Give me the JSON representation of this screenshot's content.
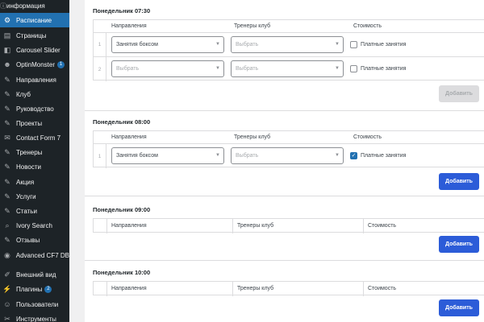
{
  "sidebar": {
    "top_label": "информация",
    "items": [
      {
        "label": "Расписание",
        "icon": "calendar-icon",
        "glyph": "⚙",
        "active": true,
        "badge": ""
      },
      {
        "label": "Страницы",
        "icon": "pages-icon",
        "glyph": "▤",
        "active": false,
        "badge": ""
      },
      {
        "label": "Carousel Slider",
        "icon": "slider-icon",
        "glyph": "◧",
        "active": false,
        "badge": ""
      },
      {
        "label": "OptinMonster",
        "icon": "optinmonster-icon",
        "glyph": "☻",
        "active": false,
        "badge": "1"
      },
      {
        "label": "Направления",
        "icon": "pin-icon",
        "glyph": "✎",
        "active": false,
        "badge": ""
      },
      {
        "label": "Клуб",
        "icon": "pin-icon",
        "glyph": "✎",
        "active": false,
        "badge": ""
      },
      {
        "label": "Руководство",
        "icon": "pin-icon",
        "glyph": "✎",
        "active": false,
        "badge": ""
      },
      {
        "label": "Проекты",
        "icon": "pin-icon",
        "glyph": "✎",
        "active": false,
        "badge": ""
      },
      {
        "label": "Contact Form 7",
        "icon": "mail-icon",
        "glyph": "✉",
        "active": false,
        "badge": ""
      },
      {
        "label": "Тренеры",
        "icon": "pin-icon",
        "glyph": "✎",
        "active": false,
        "badge": ""
      },
      {
        "label": "Новости",
        "icon": "pin-icon",
        "glyph": "✎",
        "active": false,
        "badge": ""
      },
      {
        "label": "Акция",
        "icon": "pin-icon",
        "glyph": "✎",
        "active": false,
        "badge": ""
      },
      {
        "label": "Услуги",
        "icon": "pin-icon",
        "glyph": "✎",
        "active": false,
        "badge": ""
      },
      {
        "label": "Статьи",
        "icon": "pin-icon",
        "glyph": "✎",
        "active": false,
        "badge": ""
      },
      {
        "label": "Ivory Search",
        "icon": "search-icon",
        "glyph": "⌕",
        "active": false,
        "badge": ""
      },
      {
        "label": "Отзывы",
        "icon": "pin-icon",
        "glyph": "✎",
        "active": false,
        "badge": ""
      },
      {
        "label": "Advanced CF7 DB",
        "icon": "eye-icon",
        "glyph": "◉",
        "active": false,
        "badge": ""
      },
      {
        "label": "Внешний вид",
        "icon": "brush-icon",
        "glyph": "✐",
        "active": false,
        "badge": ""
      },
      {
        "label": "Плагины",
        "icon": "plugin-icon",
        "glyph": "⚡",
        "active": false,
        "badge": "2"
      },
      {
        "label": "Пользователи",
        "icon": "user-icon",
        "glyph": "☺",
        "active": false,
        "badge": ""
      },
      {
        "label": "Инструменты",
        "icon": "wrench-icon",
        "glyph": "✂",
        "active": false,
        "badge": ""
      }
    ]
  },
  "columns": {
    "direction": "Направления",
    "trainers": "Тренеры клуб",
    "cost": "Стоимость"
  },
  "paid_label": "Платные занятия",
  "add_label": "Добавить",
  "sections": [
    {
      "title": "Понедельник 07:30",
      "rows": [
        {
          "num": "1",
          "direction": "Занятия боксом",
          "trainer": "Выбрать",
          "paid": false
        },
        {
          "num": "2",
          "direction": "Выбрать",
          "trainer": "Выбрать",
          "paid": false
        }
      ],
      "add_disabled": true
    },
    {
      "title": "Понедельник 08:00",
      "rows": [
        {
          "num": "1",
          "direction": "Занятия боксом",
          "trainer": "Выбрать",
          "paid": true
        }
      ],
      "add_disabled": false
    },
    {
      "title": "Понедельник 09:00",
      "rows": [],
      "add_disabled": false
    },
    {
      "title": "Понедельник 10:00",
      "rows": [],
      "add_disabled": false
    }
  ],
  "colors": {
    "sidebar_bg": "#1d2327",
    "active": "#2271b1",
    "primary_button": "#2c5cd8"
  }
}
